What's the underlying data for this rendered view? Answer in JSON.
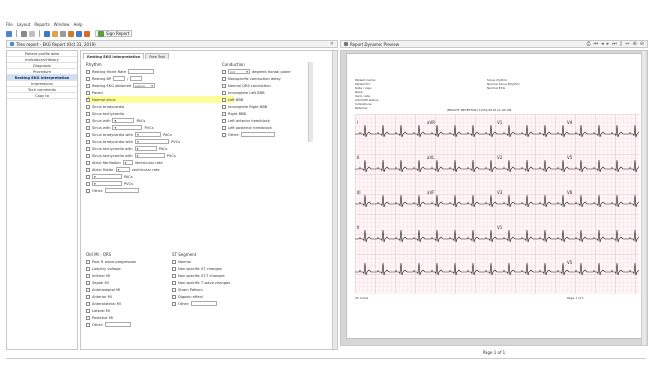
{
  "menu": [
    "File",
    "Layout",
    "Reports",
    "Window",
    "Help"
  ],
  "toolbar": {
    "icons": [
      "save-icon",
      "print-icon",
      "cut-icon",
      "copy-icon",
      "paste-icon",
      "edit-icon",
      "tools-icon",
      "help-icon",
      "find-icon"
    ],
    "sign_report_label": "Sign Report"
  },
  "left_tab": {
    "title": "Tiles report - EKG Report (Oct 31, 2019)"
  },
  "nav": {
    "items": [
      "Patient profile data",
      "Indications/History",
      "Diagnosis",
      "Procedure",
      "Resting EKG interpretation",
      "Impressions",
      "Tech comments",
      "Copy to"
    ],
    "selected_index": 4
  },
  "form_tabs": [
    "Resting EKG interpretation",
    "Free Text"
  ],
  "rhythm": {
    "title": "Rhythm",
    "items": [
      {
        "label": "Resting Heart Rate",
        "checked": false
      },
      {
        "label": "Resting BP",
        "checked": false
      },
      {
        "label": "Resting EKG obtained",
        "dropdown": "supine",
        "checked": false
      },
      {
        "label": "Paced",
        "checked": false
      },
      {
        "label": "Normal sinus",
        "checked": true
      },
      {
        "label": "Sinus bradycardia",
        "checked": false
      },
      {
        "label": "Sinus tachycardia",
        "checked": false
      },
      {
        "label": "Sinus with",
        "suffix": "PACs",
        "checked": false
      },
      {
        "label": "Sinus with",
        "suffix": "PVCs",
        "checked": false
      },
      {
        "label": "Sinus bradycardia with",
        "suffix": "PACs",
        "checked": false
      },
      {
        "label": "Sinus bradycardia with",
        "suffix": "PVCs",
        "checked": false
      },
      {
        "label": "Sinus tachycardia with",
        "suffix": "PACs",
        "checked": false
      },
      {
        "label": "Sinus tachycardia with",
        "suffix": "PVCs",
        "checked": false
      },
      {
        "label": "Atrial fibrillation",
        "suffix": "Ventricular rate",
        "checked": false
      },
      {
        "label": "Atrial flutter",
        "suffix": "ventricular rate",
        "checked": false
      },
      {
        "label": "",
        "suffix": "PACs",
        "checked": false
      },
      {
        "label": "",
        "suffix": "PVCs",
        "checked": false
      },
      {
        "label": "Other:",
        "checked": false
      }
    ]
  },
  "conduction": {
    "title": "Conduction",
    "axis_dropdown": "(nl)",
    "axis_suffix": "degrees frontal plane",
    "items": [
      "Nonspecific conduction delay",
      "Normal QRS conduction",
      "Incomplete Left BBB",
      "Left BBB",
      "Incomplete Right BBB",
      "Right BBB",
      "Left anterior hemiblock",
      "Left posterior hemiblock",
      "Other:"
    ]
  },
  "qrs": {
    "title": "Old MI - QRS",
    "items": [
      "Poor R wave progression",
      "Low/dry voltage",
      "Inferior MI",
      "Septal MI",
      "Anteroseptal MI",
      "Anterior MI",
      "Anterolateral MI",
      "Lateral MI",
      "Posterior MI",
      "Other:"
    ]
  },
  "st": {
    "title": "ST Segment",
    "items": [
      "Normal",
      "Non specific ST changes",
      "Non specific ST-T changes",
      "Non specific T wave changes",
      "Strain Pattern",
      "Digoxin effect",
      "Other:"
    ]
  },
  "right_tab": {
    "title": "Report Dynamic Preview"
  },
  "preview_tools": [
    "print-icon",
    "first-page-icon",
    "prev-page-icon",
    "next-page-icon",
    "last-page-icon",
    "fit-page-icon",
    "fit-width-icon",
    "zoom-in-icon",
    "zoom-out-icon"
  ],
  "ecg_header": {
    "col1": [
      "Patient name:",
      "Patient ID:",
      "Date / Age:",
      "Race:",
      "Vent. rate:",
      "Admit/Pt status:",
      "Indications:",
      "Referral:"
    ],
    "col2": [
      "Sinus rhythm",
      "Normal Sinus Rhythm",
      "Normal ECG"
    ],
    "caption": "(BRIGHT RECEPTOR)   10/31/2019  11:00 AM"
  },
  "ecg_leads": [
    "I",
    "aVR",
    "V1",
    "V4",
    "II",
    "aVL",
    "V2",
    "V5",
    "III",
    "aVF",
    "V3",
    "V6",
    "II",
    "V1",
    "V5"
  ],
  "ecg_footer": {
    "left": "25 mm/s",
    "right": "Page 1 of 1"
  },
  "status": {
    "page": "Page 1 of 1"
  }
}
